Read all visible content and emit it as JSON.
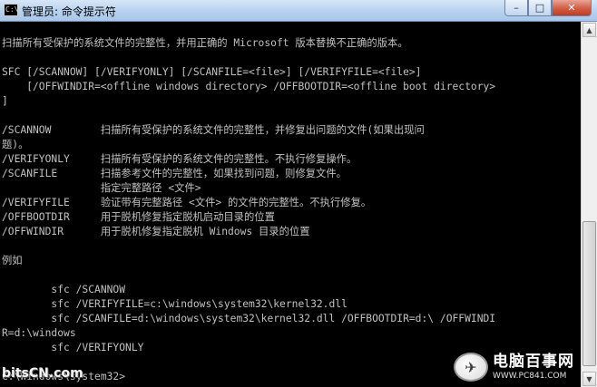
{
  "window": {
    "title": "管理员: 命令提示符",
    "icon": "cmd-icon",
    "icon_text": "C:\\",
    "buttons": {
      "minimize": "–",
      "maximize": "□",
      "close": "✕"
    }
  },
  "console": {
    "lines": [
      "扫描所有受保护的系统文件的完整性，并用正确的 Microsoft 版本替换不正确的版本。",
      "",
      "SFC [/SCANNOW] [/VERIFYONLY] [/SCANFILE=<file>] [/VERIFYFILE=<file>]",
      "    [/OFFWINDIR=<offline windows directory> /OFFBOOTDIR=<offline boot directory>",
      "]",
      "",
      "/SCANNOW        扫描所有受保护的系统文件的完整性，并修复出问题的文件(如果出现问",
      "题)。",
      "/VERIFYONLY     扫描所有受保护的系统文件的完整性。不执行修复操作。",
      "/SCANFILE       扫描参考文件的完整性，如果找到问题，则修复文件。",
      "                指定完整路径 <文件>",
      "/VERIFYFILE     验证带有完整路径 <文件> 的文件的完整性。不执行修复。",
      "/OFFBOOTDIR     用于脱机修复指定脱机启动目录的位置",
      "/OFFWINDIR      用于脱机修复指定脱机 Windows 目录的位置",
      "",
      "例如",
      "",
      "        sfc /SCANNOW",
      "        sfc /VERIFYFILE=c:\\windows\\system32\\kernel32.dll",
      "        sfc /SCANFILE=d:\\windows\\system32\\kernel32.dll /OFFBOOTDIR=d:\\ /OFFWINDI",
      "R=d:\\windows",
      "        sfc /VERIFYONLY",
      "",
      "C:\\Windows\\system32>"
    ]
  },
  "scrollbar": {
    "up": "▲",
    "down": "▼"
  },
  "watermarks": {
    "left": "bitsCN.com",
    "right_name": "电脑百事网",
    "right_url": "WWW.PC841.COM",
    "right_logo_glyph": "✈"
  }
}
